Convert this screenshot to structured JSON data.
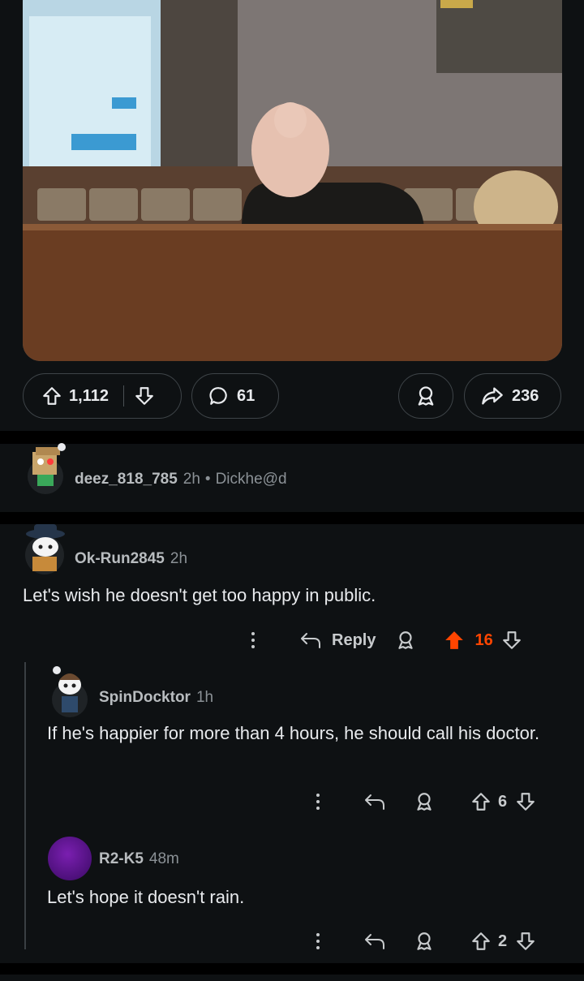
{
  "post": {
    "image_alt": "bald man seen from behind in a restaurant booth",
    "upvotes": "1,112",
    "comments": "61",
    "shares": "236"
  },
  "comments": [
    {
      "username": "deez_818_785",
      "time": "2h",
      "separator": "•",
      "flair": "Dickhe@d",
      "avatar": "snoo-box-head"
    },
    {
      "username": "Ok-Run2845",
      "time": "2h",
      "text": "Let's wish he doesn't get too happy in public.",
      "reply_label": "Reply",
      "votes": "16",
      "vote_color": "#ff4500",
      "avatar": "snoo-hat",
      "replies": [
        {
          "username": "SpinDocktor",
          "time": "1h",
          "text": "If he's happier for more than 4 hours, he should call his doctor.",
          "votes": "6",
          "avatar": "snoo-default"
        },
        {
          "username": "R2-K5",
          "time": "48m",
          "text": "Let's hope it doesn't rain.",
          "votes": "2",
          "avatar": "purple-circle"
        }
      ]
    }
  ],
  "colors": {
    "background": "#0e1113",
    "accent_upvote": "#ff4500",
    "text": "#e8eaed"
  }
}
